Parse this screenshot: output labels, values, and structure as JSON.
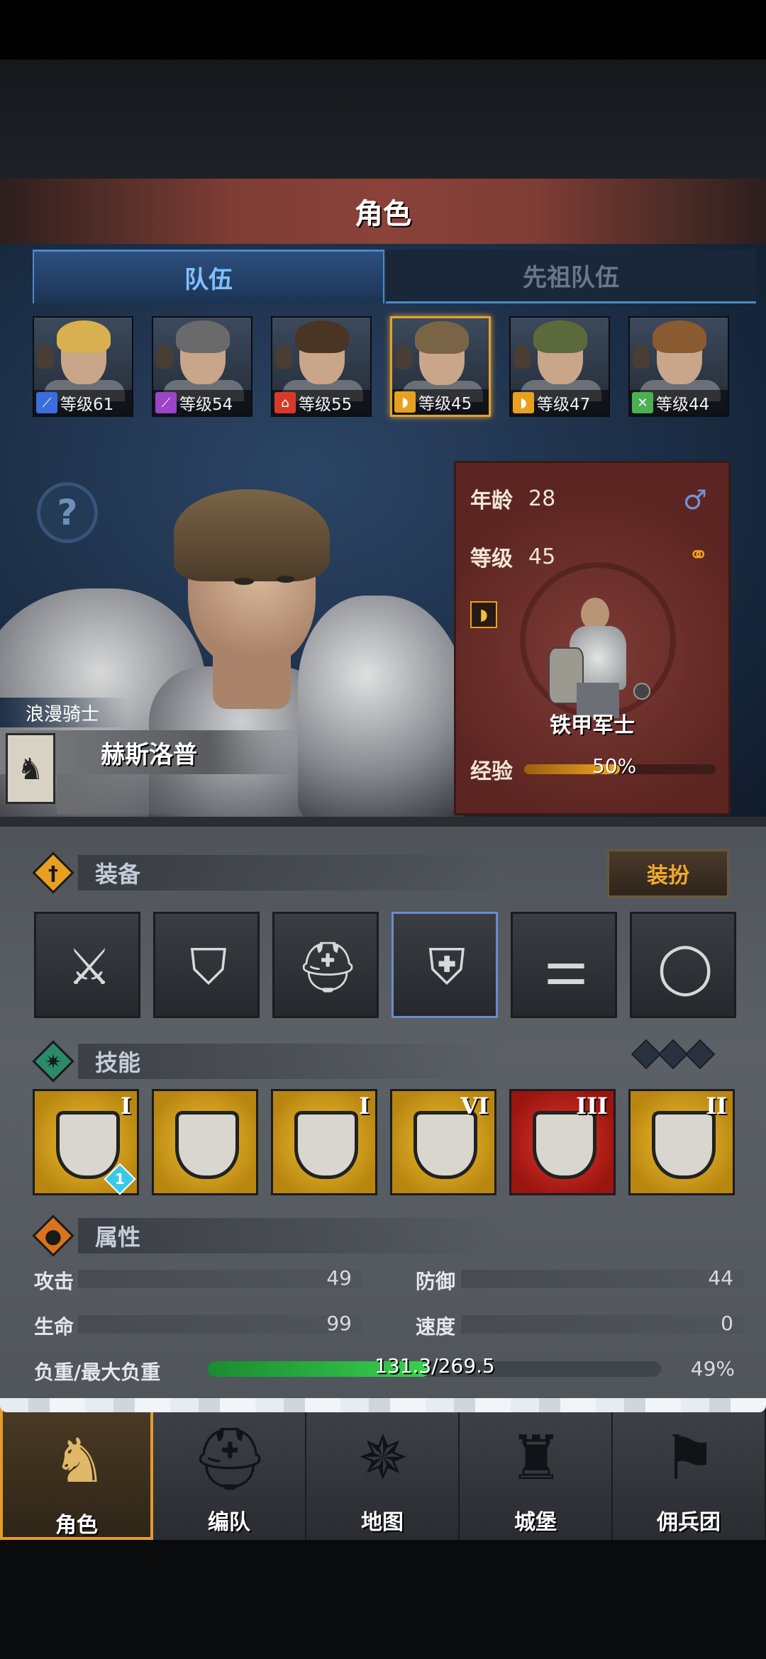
{
  "title": "角色",
  "tabs": {
    "team": "队伍",
    "ancestor_team": "先祖队伍"
  },
  "roster": [
    {
      "level": "等级61",
      "class_icon": "sword-icon",
      "class_color": "#3a6ee0",
      "hair": "#d8b050",
      "selected": false
    },
    {
      "level": "等级54",
      "class_icon": "staff-icon",
      "class_color": "#9a44c8",
      "hair": "#6a6a6a",
      "selected": false
    },
    {
      "level": "等级55",
      "class_icon": "house-icon",
      "class_color": "#d83a2a",
      "hair": "#4a3424",
      "selected": false
    },
    {
      "level": "等级45",
      "class_icon": "shield-icon",
      "class_color": "#e8a020",
      "hair": "#7a6446",
      "selected": true
    },
    {
      "level": "等级47",
      "class_icon": "shield-icon",
      "class_color": "#e8a020",
      "hair": "#5a6a3a",
      "selected": false
    },
    {
      "level": "等级44",
      "class_icon": "bow-icon",
      "class_color": "#4ab050",
      "hair": "#8a5a30",
      "selected": false
    }
  ],
  "hero": {
    "title": "浪漫骑士",
    "name": "赫斯洛普"
  },
  "info": {
    "age_label": "年龄",
    "age": "28",
    "level_label": "等级",
    "level": "45",
    "class_name": "铁甲军士",
    "xp_label": "经验",
    "xp_text": "50%",
    "xp_fraction": 0.5,
    "gender_icon": "male-icon"
  },
  "equipment": {
    "section": "装备",
    "dress_button": "装扮",
    "items": [
      "flail-icon",
      "shield-item-icon",
      "helmet-icon",
      "chest-armor-icon",
      "boots-icon",
      "ring-icon"
    ]
  },
  "skills": {
    "section": "技能",
    "items": [
      {
        "rank": "I",
        "color": "gold",
        "badge": "1"
      },
      {
        "rank": "",
        "color": "gold",
        "badge": ""
      },
      {
        "rank": "I",
        "color": "gold",
        "badge": ""
      },
      {
        "rank": "VI",
        "color": "gold",
        "badge": ""
      },
      {
        "rank": "III",
        "color": "red",
        "badge": ""
      },
      {
        "rank": "II",
        "color": "gold",
        "badge": ""
      }
    ]
  },
  "attributes": {
    "section": "属性",
    "attack_label": "攻击",
    "attack": "49",
    "defense_label": "防御",
    "defense": "44",
    "life_label": "生命",
    "life": "99",
    "speed_label": "速度",
    "speed": "0",
    "weight_label": "负重/最大负重",
    "weight_text": "131.3/269.5",
    "weight_percent": "49%",
    "weight_fraction": 0.49
  },
  "nav": [
    {
      "label": "角色",
      "icon": "knight-icon",
      "selected": true
    },
    {
      "label": "编队",
      "icon": "helmet-icon",
      "selected": false
    },
    {
      "label": "地图",
      "icon": "compass-icon",
      "selected": false
    },
    {
      "label": "城堡",
      "icon": "castle-icon",
      "selected": false
    },
    {
      "label": "佣兵团",
      "icon": "banner-icon",
      "selected": false
    }
  ]
}
